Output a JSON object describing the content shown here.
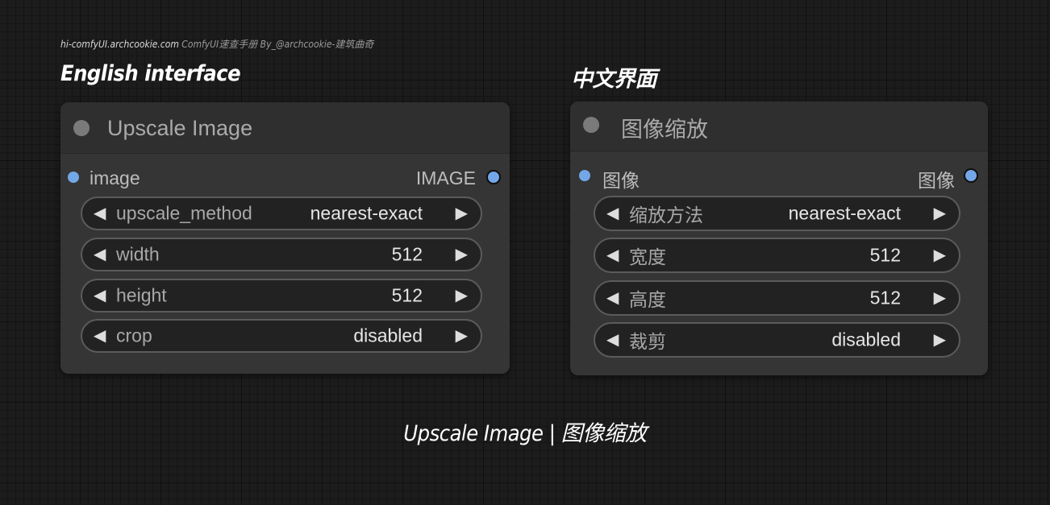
{
  "watermark": {
    "site": "hi-comfyUI.archcookie.com",
    "text": "ComfyUI速查手册 By_@archcookie-建筑曲奇"
  },
  "sections": {
    "english": "English interface",
    "chinese": "中文界面"
  },
  "nodes": {
    "english": {
      "title": "Upscale Image",
      "input_label": "image",
      "output_label": "IMAGE",
      "widgets": [
        {
          "label": "upscale_method",
          "value": "nearest-exact"
        },
        {
          "label": "width",
          "value": "512"
        },
        {
          "label": "height",
          "value": "512"
        },
        {
          "label": "crop",
          "value": "disabled"
        }
      ]
    },
    "chinese": {
      "title": "图像缩放",
      "input_label": "图像",
      "output_label": "图像",
      "widgets": [
        {
          "label": "缩放方法",
          "value": "nearest-exact"
        },
        {
          "label": "宽度",
          "value": "512"
        },
        {
          "label": "高度",
          "value": "512"
        },
        {
          "label": "裁剪",
          "value": "disabled"
        }
      ]
    }
  },
  "caption": "Upscale Image | 图像缩放",
  "icons": {
    "decrement": "◀",
    "increment": "▶"
  },
  "colors": {
    "slot_image": "#73a7e8",
    "node_body": "#353535",
    "node_header": "#2f2f2f",
    "widget_bg": "#222222",
    "widget_border": "#5b5b5b"
  }
}
